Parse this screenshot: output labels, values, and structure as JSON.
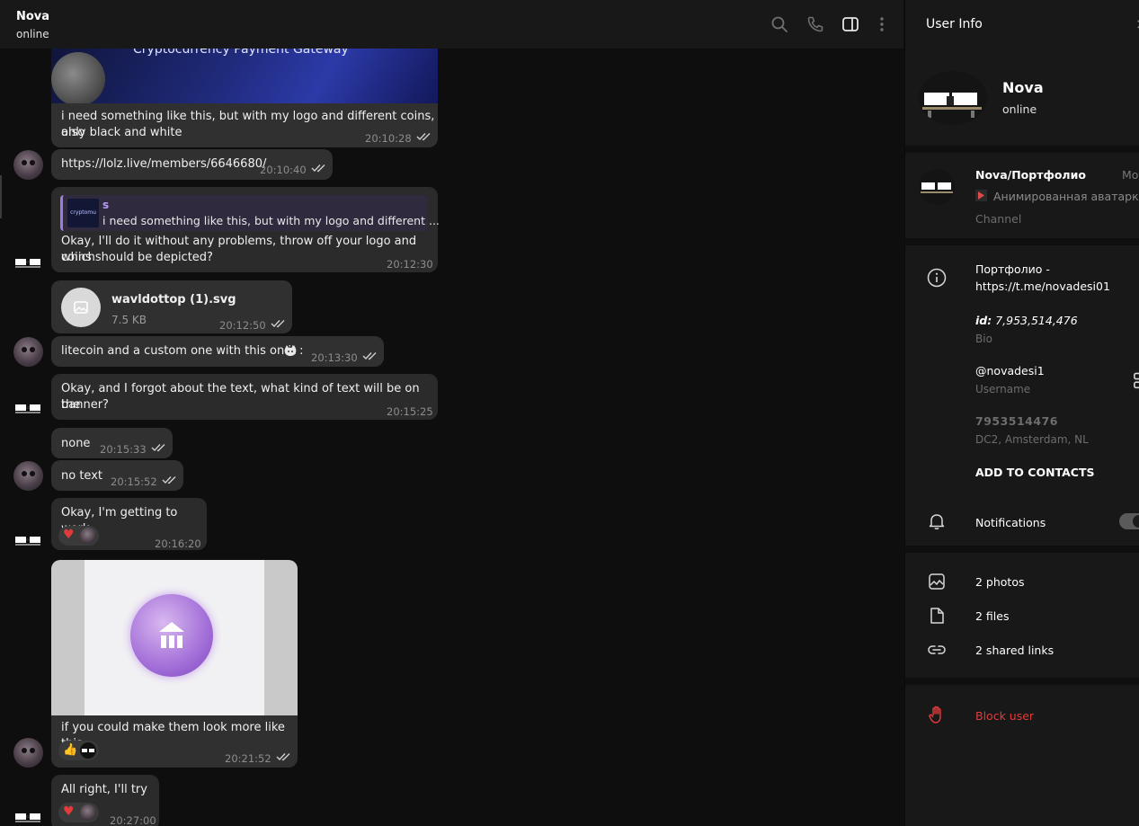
{
  "header": {
    "name": "Nova",
    "status": "online",
    "icons": [
      "search-icon",
      "phone-icon",
      "sidebar-toggle-icon",
      "more-vertical-icon"
    ]
  },
  "messages": {
    "banner_caption": "Cryptocurrency Payment Gateway",
    "m1": {
      "text_l1": "i need something like this, but with my logo and different coins, also",
      "text_l2": "only black and white",
      "time": "20:10:28"
    },
    "m2": {
      "text": "https://lolz.live/members/6646680/",
      "time": "20:10:40"
    },
    "m3": {
      "reply_author": "s",
      "reply_thumb": "cryptomu",
      "reply_text": "i need something like this, but with my logo and different ...",
      "text_l1": "Okay, I'll do it without any problems, throw off your logo and which",
      "text_l2": "coins should be depicted?",
      "time": "20:12:30"
    },
    "m4": {
      "filename": "wavldottop (1).svg",
      "size": "7.5 KB",
      "time": "20:12:50"
    },
    "m5": {
      "text": "litecoin and a custom one with this on it :",
      "time": "20:13:30"
    },
    "m6": {
      "text_l1": "Okay, and I forgot about the text, what kind of text will be on the",
      "text_l2": "banner?",
      "time": "20:15:25"
    },
    "m7": {
      "text": "none",
      "time": "20:15:33"
    },
    "m8": {
      "text": "no text",
      "time": "20:15:52"
    },
    "m9": {
      "text": "Okay, I'm getting to work",
      "time": "20:16:20"
    },
    "m10": {
      "text": "if you could make them look more like this",
      "time": "20:21:52"
    },
    "m11": {
      "text": "All right, I'll try",
      "time": "20:27:00"
    }
  },
  "panel": {
    "title": "User Info",
    "name": "Nova",
    "status": "online",
    "channel": {
      "title": "Nova/Портфолио",
      "extra": "Mo",
      "desc": "Анимированная аватарка",
      "label": "Channel"
    },
    "bio_l1": "Портфолио -",
    "bio_l2": "https://t.me/novadesi01",
    "id_prefix": "id:",
    "id_value": "7,953,514,476",
    "bio_label": "Bio",
    "username": "@novadesi1",
    "username_label": "Username",
    "phone": "7953514476",
    "dc": "DC2, Amsterdam, NL",
    "add_contacts": "ADD TO CONTACTS",
    "notifications": "Notifications",
    "photos": "2 photos",
    "files": "2 files",
    "links": "2 shared links",
    "block": "Block user"
  },
  "colors": {
    "accent_red": "#e23b3b",
    "bubble": "#2b2b2b",
    "panel_bg": "#181818"
  }
}
